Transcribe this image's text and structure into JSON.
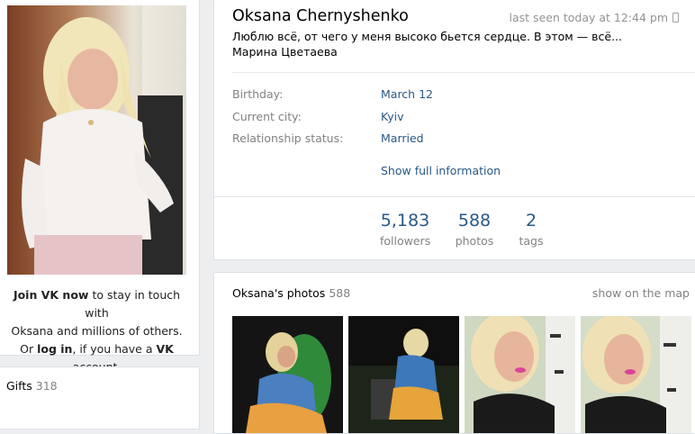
{
  "left": {
    "join": {
      "join_link": "Join VK now",
      "text1": " to stay in touch with",
      "text2": "Oksana and millions of others.",
      "or_text": "Or ",
      "login_link": "log in",
      "text3": ", if you have a ",
      "vk": "VK",
      "text4": " account."
    },
    "gifts": {
      "label": "Gifts",
      "count": "318"
    }
  },
  "profile": {
    "name": "Oksana Chernyshenko",
    "last_seen": "last seen today at 12:44 pm",
    "status": "Люблю всё, от чего у меня высоко бьется сердце. В этом — всё... Марина Цветаева",
    "info": [
      {
        "label": "Birthday:",
        "value": "March 12"
      },
      {
        "label": "Current city:",
        "value": "Kyiv"
      },
      {
        "label": "Relationship status:",
        "value": "Married"
      }
    ],
    "show_full": "Show full information",
    "counters": [
      {
        "num": "5,183",
        "label": "followers"
      },
      {
        "num": "588",
        "label": "photos"
      },
      {
        "num": "2",
        "label": "tags"
      }
    ]
  },
  "photos": {
    "title": "Oksana's photos",
    "count": "588",
    "show_map": "show on the map"
  },
  "colors": {
    "link": "#2a5885",
    "muted": "#828282",
    "bg": "#edeef0"
  },
  "icons": [
    "phone-icon"
  ]
}
